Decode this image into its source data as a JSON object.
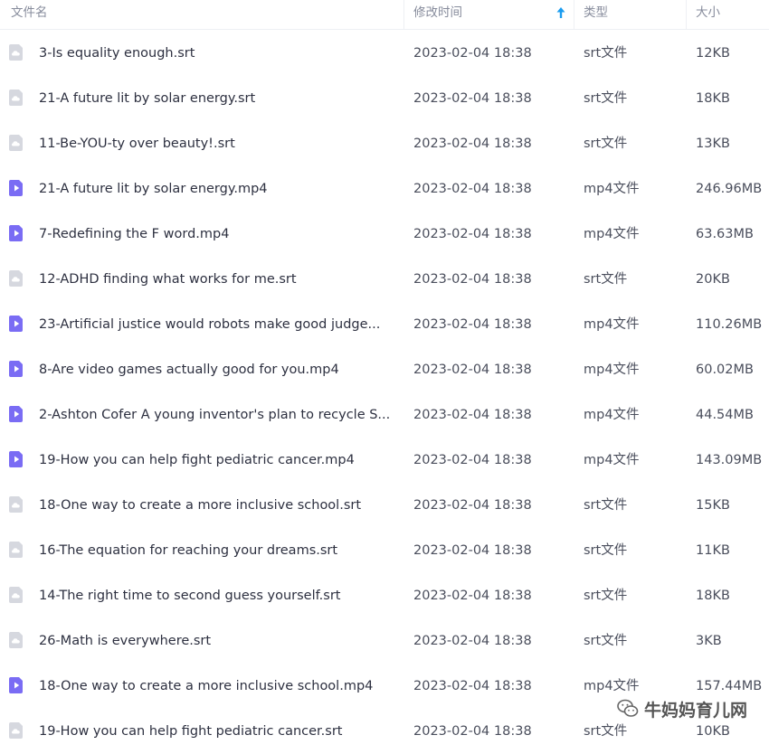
{
  "header": {
    "name": "文件名",
    "modified": "修改时间",
    "type": "类型",
    "size": "大小",
    "sort_icon": "arrow-up-icon",
    "sort_color": "#1a9cf0"
  },
  "colors": {
    "video_icon": "#7a6cf4",
    "subtitle_icon": "#d6d8df"
  },
  "files": [
    {
      "icon": "subtitle-file-icon",
      "name": "3-Is equality enough.srt",
      "modified": "2023-02-04 18:38",
      "type": "srt文件",
      "size": "12KB"
    },
    {
      "icon": "subtitle-file-icon",
      "name": "21-A future lit by solar energy.srt",
      "modified": "2023-02-04 18:38",
      "type": "srt文件",
      "size": "18KB"
    },
    {
      "icon": "subtitle-file-icon",
      "name": "11-Be-YOU-ty over beauty!.srt",
      "modified": "2023-02-04 18:38",
      "type": "srt文件",
      "size": "13KB"
    },
    {
      "icon": "video-file-icon",
      "name": "21-A future lit by solar energy.mp4",
      "modified": "2023-02-04 18:38",
      "type": "mp4文件",
      "size": "246.96MB"
    },
    {
      "icon": "video-file-icon",
      "name": "7-Redefining the F word.mp4",
      "modified": "2023-02-04 18:38",
      "type": "mp4文件",
      "size": "63.63MB"
    },
    {
      "icon": "subtitle-file-icon",
      "name": "12-ADHD finding what works for me.srt",
      "modified": "2023-02-04 18:38",
      "type": "srt文件",
      "size": "20KB"
    },
    {
      "icon": "video-file-icon",
      "name": "23-Artificial justice would robots make good judge...",
      "modified": "2023-02-04 18:38",
      "type": "mp4文件",
      "size": "110.26MB"
    },
    {
      "icon": "video-file-icon",
      "name": "8-Are video games actually good for you.mp4",
      "modified": "2023-02-04 18:38",
      "type": "mp4文件",
      "size": "60.02MB"
    },
    {
      "icon": "video-file-icon",
      "name": "2-Ashton Cofer A young inventor's plan to recycle S...",
      "modified": "2023-02-04 18:38",
      "type": "mp4文件",
      "size": "44.54MB"
    },
    {
      "icon": "video-file-icon",
      "name": "19-How you can help fight pediatric cancer.mp4",
      "modified": "2023-02-04 18:38",
      "type": "mp4文件",
      "size": "143.09MB"
    },
    {
      "icon": "subtitle-file-icon",
      "name": "18-One way to create a more inclusive school.srt",
      "modified": "2023-02-04 18:38",
      "type": "srt文件",
      "size": "15KB"
    },
    {
      "icon": "subtitle-file-icon",
      "name": "16-The equation for reaching your dreams.srt",
      "modified": "2023-02-04 18:38",
      "type": "srt文件",
      "size": "11KB"
    },
    {
      "icon": "subtitle-file-icon",
      "name": "14-The right time to second guess yourself.srt",
      "modified": "2023-02-04 18:38",
      "type": "srt文件",
      "size": "18KB"
    },
    {
      "icon": "subtitle-file-icon",
      "name": "26-Math is everywhere.srt",
      "modified": "2023-02-04 18:38",
      "type": "srt文件",
      "size": "3KB"
    },
    {
      "icon": "video-file-icon",
      "name": "18-One way to create a more inclusive school.mp4",
      "modified": "2023-02-04 18:38",
      "type": "mp4文件",
      "size": "157.44MB"
    },
    {
      "icon": "subtitle-file-icon",
      "name": "19-How you can help fight pediatric cancer.srt",
      "modified": "2023-02-04 18:38",
      "type": "srt文件",
      "size": "10KB"
    }
  ],
  "watermark": {
    "text": "牛妈妈育儿网",
    "icon": "wechat-icon"
  }
}
